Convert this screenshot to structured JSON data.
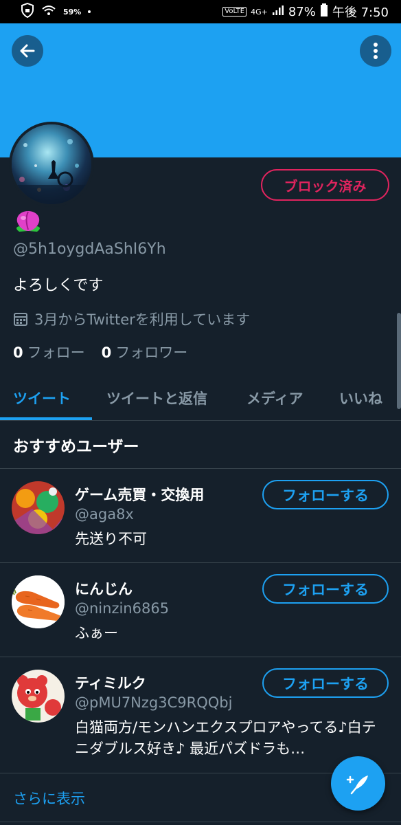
{
  "status_bar": {
    "battery_saver": "59%",
    "volte": "VoLTE",
    "network": "4G+",
    "battery": "87%",
    "time": "午後 7:50"
  },
  "profile": {
    "blocked_label": "ブロック済み",
    "handle": "@5h1oygdAaShI6Yh",
    "bio": "よろしくです",
    "joined": "3月からTwitterを利用しています",
    "following_count": "0",
    "following_label": "フォロー",
    "followers_count": "0",
    "followers_label": "フォロワー"
  },
  "tabs": [
    {
      "label": "ツイート",
      "active": true
    },
    {
      "label": "ツイートと返信",
      "active": false
    },
    {
      "label": "メディア",
      "active": false
    },
    {
      "label": "いいね",
      "active": false
    }
  ],
  "recommended": {
    "title": "おすすめユーザー",
    "follow_label": "フォローする",
    "users": [
      {
        "name": "ゲーム売買・交換用",
        "handle": "@aga8x",
        "bio": "先送り不可"
      },
      {
        "name": "にんじん",
        "handle": "@ninzin6865",
        "bio": "ふぁー"
      },
      {
        "name": "ティミルク",
        "handle": "@pMU7Nzg3C9RQQbj",
        "bio": "白猫両方/モンハンエクスプロアやってる♪白テニダブルス好き♪ 最近パズドラも…"
      }
    ],
    "show_more": "さらに表示"
  },
  "colors": {
    "accent": "#1da1f2",
    "block": "#e0245e",
    "background": "#15202b"
  }
}
